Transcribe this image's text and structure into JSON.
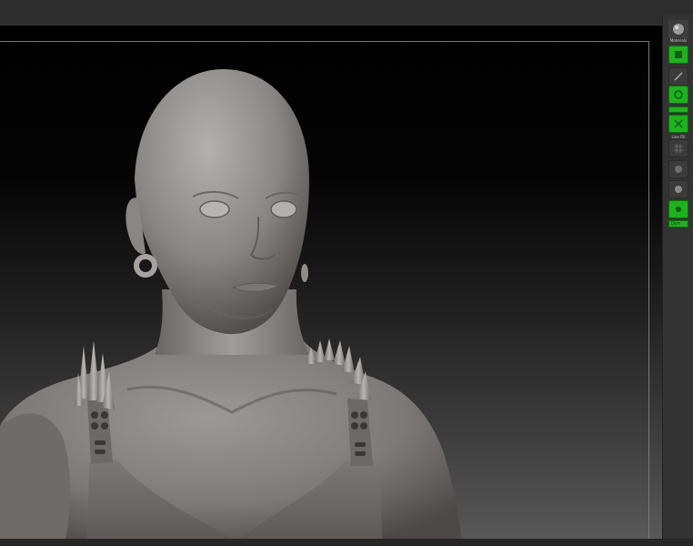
{
  "right_shelf": {
    "items": [
      {
        "name": "material-sphere",
        "label": "Materials",
        "state": "default"
      },
      {
        "name": "edit",
        "label": "",
        "state": "on"
      },
      {
        "name": "draw",
        "label": "",
        "state": "off"
      },
      {
        "name": "gizmo",
        "label": "",
        "state": "on"
      },
      {
        "name": "scale",
        "label": "",
        "state": "on"
      },
      {
        "name": "line-fill",
        "label": "Line Fill",
        "state": "off"
      },
      {
        "name": "transp",
        "label": "",
        "state": "off"
      },
      {
        "name": "ghost",
        "label": "",
        "state": "off"
      },
      {
        "name": "solo",
        "label": "",
        "state": "on"
      },
      {
        "name": "dyn",
        "label": "Dyn",
        "state": "on"
      }
    ]
  },
  "colors": {
    "active_green": "#20b020",
    "shelf_bg": "#333333",
    "clay": "#8c8886"
  }
}
